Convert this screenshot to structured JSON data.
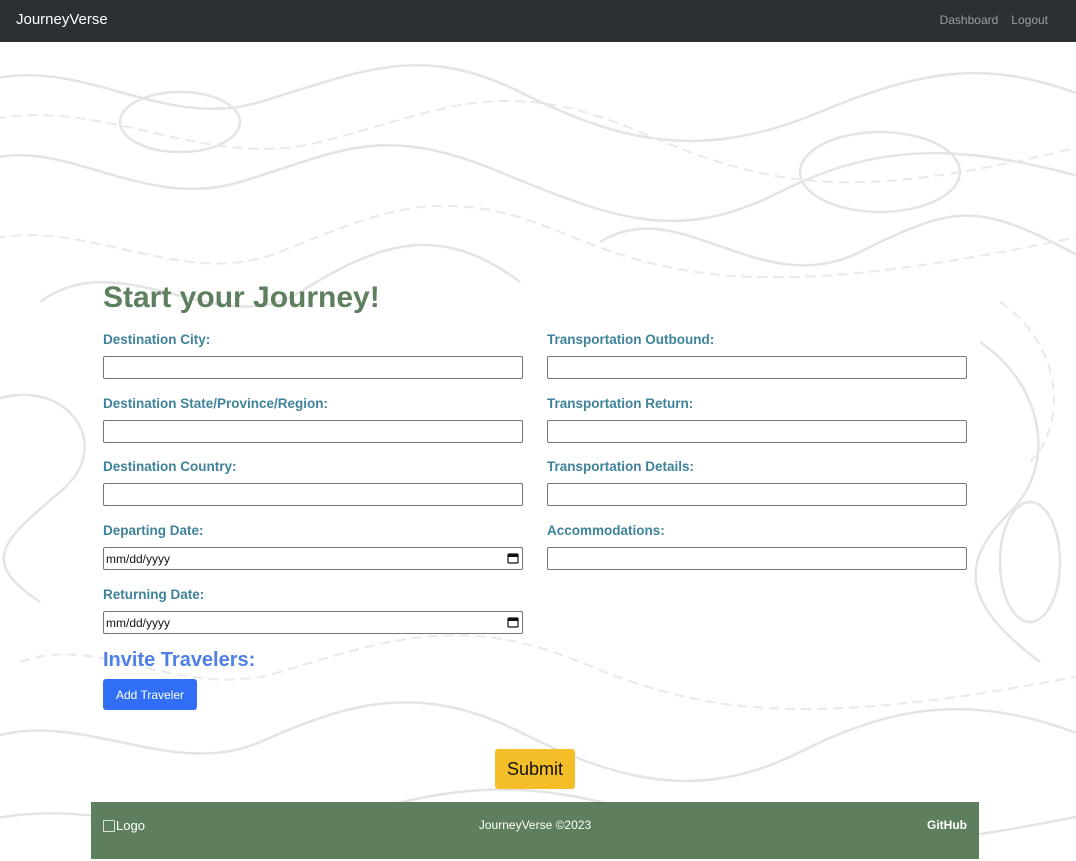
{
  "nav": {
    "brand": "JourneyVerse",
    "links": [
      "Dashboard",
      "Logout"
    ]
  },
  "form": {
    "title": "Start your Journey!",
    "left_fields": [
      {
        "label": "Destination City:",
        "value": ""
      },
      {
        "label": "Destination State/Province/Region:",
        "value": ""
      },
      {
        "label": "Destination Country:",
        "value": ""
      },
      {
        "label": "Departing Date:",
        "value": "mm/dd/yyyy"
      },
      {
        "label": "Returning Date:",
        "value": "mm/dd/yyyy"
      }
    ],
    "right_fields": [
      {
        "label": "Transportation Outbound:",
        "value": ""
      },
      {
        "label": "Transportation Return:",
        "value": ""
      },
      {
        "label": "Transportation Details:",
        "value": ""
      },
      {
        "label": "Accommodations:",
        "value": ""
      }
    ],
    "invite_heading": "Invite Travelers:",
    "add_traveler_label": "Add Traveler",
    "submit_label": "Submit"
  },
  "footer": {
    "logo_alt": "Logo",
    "copyright": "JourneyVerse ©2023",
    "github": "GitHub"
  },
  "colors": {
    "navbar": "#2b3035",
    "title": "#5e7f5d",
    "label": "#3e8399",
    "invite": "#4f80e8",
    "add_button": "#2f6ef5",
    "submit_button": "#f4be28",
    "footer": "#5e7f5d"
  }
}
